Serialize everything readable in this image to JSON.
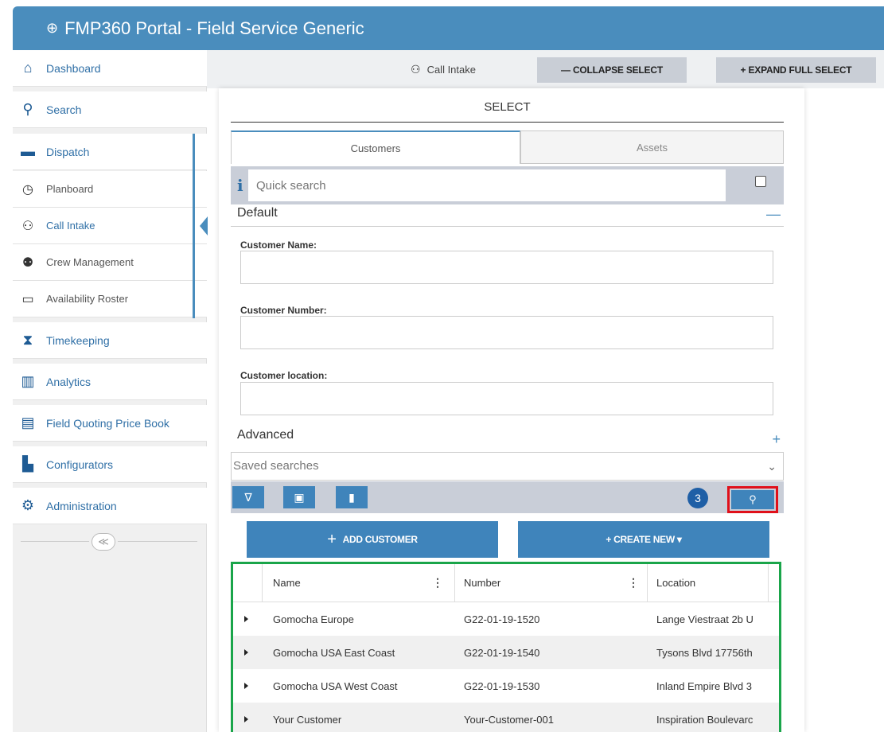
{
  "app": {
    "title": "FMP360 Portal - Field Service Generic",
    "logo_glyph": "⊕"
  },
  "sidebar": {
    "items": [
      {
        "label": "Dashboard",
        "icon": "home-icon",
        "glyph": "⌂"
      },
      {
        "label": "Search",
        "icon": "search-icon",
        "glyph": "⚲"
      },
      {
        "label": "Dispatch",
        "icon": "briefcase-icon",
        "glyph": "▬"
      },
      {
        "label": "Planboard",
        "icon": "clock-icon",
        "glyph": "◷"
      },
      {
        "label": "Call Intake",
        "icon": "binoculars-icon",
        "glyph": "⚇"
      },
      {
        "label": "Crew Management",
        "icon": "users-icon",
        "glyph": "⚉"
      },
      {
        "label": "Availability Roster",
        "icon": "calendar-icon",
        "glyph": "▭"
      },
      {
        "label": "Timekeeping",
        "icon": "hourglass-icon",
        "glyph": "⧗"
      },
      {
        "label": "Analytics",
        "icon": "bar-chart-icon",
        "glyph": "▥"
      },
      {
        "label": "Field Quoting Price Book",
        "icon": "book-icon",
        "glyph": "▤"
      },
      {
        "label": "Configurators",
        "icon": "factory-icon",
        "glyph": "▙"
      },
      {
        "label": "Administration",
        "icon": "cogs-icon",
        "glyph": "⚙"
      }
    ],
    "collapse_glyph": "≪"
  },
  "toolbar": {
    "breadcrumb": "Call Intake",
    "breadcrumb_glyph": "⚇",
    "collapse_label": "— COLLAPSE SELECT",
    "expand_label": "+ EXPAND FULL SELECT"
  },
  "panel": {
    "title": "SELECT",
    "tabs": [
      {
        "label": "Customers",
        "active": true
      },
      {
        "label": "Assets",
        "active": false
      }
    ],
    "quick_search": {
      "placeholder": "Quick search",
      "info_glyph": "i"
    },
    "default_section": {
      "title": "Default",
      "toggle": "—"
    },
    "fields": [
      {
        "label": "Customer Name:",
        "value": ""
      },
      {
        "label": "Customer Number:",
        "value": ""
      },
      {
        "label": "Customer location:",
        "value": ""
      }
    ],
    "advanced_section": {
      "title": "Advanced",
      "toggle": "+"
    },
    "saved_searches": {
      "placeholder": "Saved searches",
      "chevron": "⌄"
    },
    "actions": {
      "filter_glyph": "∇",
      "save_glyph": "▣",
      "delete_glyph": "▮",
      "result_count": "3",
      "search_glyph": "⚲"
    },
    "add_customer_label": "ADD CUSTOMER",
    "create_new_label": "+ CREATE NEW ▾"
  },
  "grid": {
    "columns": [
      "Name",
      "Number",
      "Location"
    ],
    "kebab_glyph": "⋮",
    "rows": [
      {
        "name": "Gomocha Europe",
        "number": "G22-01-19-1520",
        "location": "Lange Viestraat 2b U"
      },
      {
        "name": "Gomocha USA East Coast",
        "number": "G22-01-19-1540",
        "location": "Tysons Blvd 17756th"
      },
      {
        "name": "Gomocha USA West Coast",
        "number": "G22-01-19-1530",
        "location": "Inland Empire Blvd 3"
      },
      {
        "name": "Your Customer",
        "number": "Your-Customer-001",
        "location": "Inspiration Boulevarc"
      }
    ]
  },
  "colors": {
    "header": "#4a8dbd",
    "button": "#3f84bb",
    "highlight_red": "#e0101a",
    "highlight_green": "#1aa54a",
    "badge": "#1f5fa6"
  }
}
